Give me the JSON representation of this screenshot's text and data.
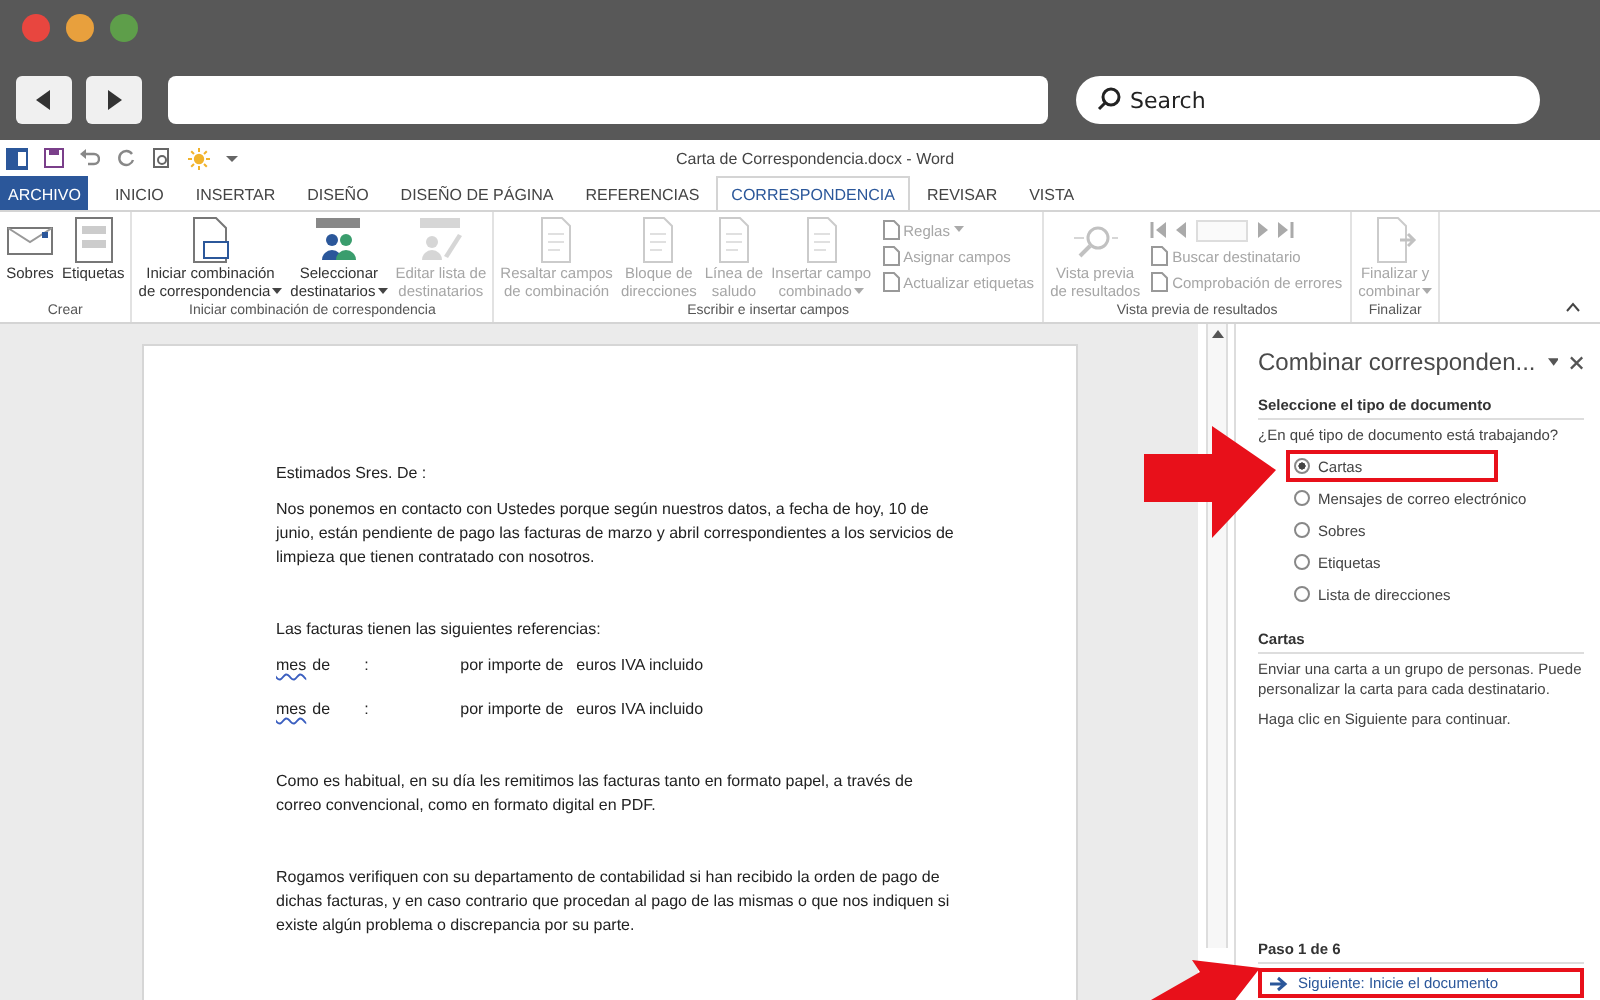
{
  "browser": {
    "search": {
      "placeholder": "Search"
    }
  },
  "word": {
    "title": "Carta de Correspondencia.docx - Word",
    "tabs": [
      {
        "label": "ARCHIVO",
        "kind": "file",
        "selected": false
      },
      {
        "label": "INICIO",
        "kind": "tab",
        "selected": false
      },
      {
        "label": "INSERTAR",
        "kind": "tab",
        "selected": false
      },
      {
        "label": "DISEÑO",
        "kind": "tab",
        "selected": false
      },
      {
        "label": "DISEÑO DE PÁGINA",
        "kind": "tab",
        "selected": false
      },
      {
        "label": "REFERENCIAS",
        "kind": "tab",
        "selected": false
      },
      {
        "label": "CORRESPONDENCIA",
        "kind": "tab",
        "selected": true
      },
      {
        "label": "REVISAR",
        "kind": "tab",
        "selected": false
      },
      {
        "label": "VISTA",
        "kind": "tab",
        "selected": false
      }
    ],
    "ribbon": [
      {
        "label": "Crear",
        "items": [
          {
            "kind": "large",
            "lines": [
              "Sobres"
            ],
            "dropdown": false,
            "disabled": false
          },
          {
            "kind": "large",
            "lines": [
              "Etiquetas"
            ],
            "dropdown": false,
            "disabled": false
          }
        ]
      },
      {
        "label": "Iniciar combinación de correspondencia",
        "items": [
          {
            "kind": "large",
            "lines": [
              "Iniciar combinación",
              "de correspondencia"
            ],
            "dropdown": true,
            "disabled": false
          },
          {
            "kind": "large",
            "lines": [
              "Seleccionar",
              "destinatarios"
            ],
            "dropdown": true,
            "disabled": false
          },
          {
            "kind": "large",
            "lines": [
              "Editar lista de",
              "destinatarios"
            ],
            "dropdown": false,
            "disabled": true
          }
        ]
      },
      {
        "label": "Escribir e insertar campos",
        "items": [
          {
            "kind": "large",
            "lines": [
              "Resaltar campos",
              "de combinación"
            ],
            "dropdown": false,
            "disabled": true
          },
          {
            "kind": "large",
            "lines": [
              "Bloque de",
              "direcciones"
            ],
            "dropdown": false,
            "disabled": true
          },
          {
            "kind": "large",
            "lines": [
              "Línea de",
              "saludo"
            ],
            "dropdown": false,
            "disabled": true
          },
          {
            "kind": "large",
            "lines": [
              "Insertar campo",
              "combinado"
            ],
            "dropdown": true,
            "disabled": true
          },
          {
            "kind": "stack",
            "items": [
              {
                "kind": "small",
                "label": "Reglas",
                "dropdown": true,
                "disabled": true
              },
              {
                "kind": "small",
                "label": "Asignar campos",
                "dropdown": false,
                "disabled": true
              },
              {
                "kind": "small",
                "label": "Actualizar etiquetas",
                "dropdown": false,
                "disabled": true
              }
            ]
          }
        ]
      },
      {
        "label": "Vista previa de resultados",
        "items": [
          {
            "kind": "large",
            "lines": [
              "Vista previa",
              "de resultados"
            ],
            "dropdown": false,
            "disabled": true
          },
          {
            "kind": "stack",
            "items": [
              {
                "kind": "nav",
                "disabled": true
              },
              {
                "kind": "small",
                "label": "Buscar destinatario",
                "dropdown": false,
                "disabled": true
              },
              {
                "kind": "small",
                "label": "Comprobación de errores",
                "dropdown": false,
                "disabled": true
              }
            ]
          }
        ]
      },
      {
        "label": "Finalizar",
        "items": [
          {
            "kind": "large",
            "lines": [
              "Finalizar y",
              "combinar"
            ],
            "dropdown": true,
            "disabled": true
          }
        ]
      }
    ],
    "document": [
      {
        "kind": "para",
        "text": "Estimados Sres. De   :"
      },
      {
        "kind": "para",
        "text": "Nos ponemos en contacto con Ustedes porque según nuestros datos, a fecha de hoy, 10 de junio, están pendiente de pago las facturas de marzo y abril correspondientes a los servicios de limpieza que tienen contratado con nosotros."
      },
      {
        "kind": "para_after_blank",
        "text": "Las facturas tienen las siguientes referencias:"
      },
      {
        "kind": "row",
        "cells": [
          {
            "text": "mes",
            "misspelled": true
          },
          {
            "text": "de",
            "misspelled": false
          },
          {
            "text": ":",
            "misspelled": false
          },
          {
            "text": "por importe de",
            "misspelled": false
          },
          {
            "text": "euros IVA incluido",
            "misspelled": false
          }
        ]
      },
      {
        "kind": "row",
        "cells": [
          {
            "text": "mes",
            "misspelled": true
          },
          {
            "text": "de",
            "misspelled": false
          },
          {
            "text": ":",
            "misspelled": false
          },
          {
            "text": "por importe de",
            "misspelled": false
          },
          {
            "text": "euros IVA incluido",
            "misspelled": false
          }
        ]
      },
      {
        "kind": "para_after_blank",
        "text": "Como es habitual, en su día les remitimos las facturas tanto en formato papel, a través de correo convencional, como en formato digital en PDF."
      },
      {
        "kind": "para_after_blank",
        "text": "Rogamos verifiquen con su departamento de contabilidad si han recibido la orden de pago de dichas facturas, y en caso contrario que procedan al pago de las mismas o que nos indiquen si existe algún problema o discrepancia por su parte."
      }
    ],
    "pane": {
      "title": "Combinar corresponden...",
      "section_1": "Seleccione el tipo de documento",
      "question": "¿En qué tipo de documento está trabajando?",
      "options": [
        {
          "label": "Cartas",
          "selected": true,
          "highlighted": true
        },
        {
          "label": "Mensajes de correo electrónico",
          "selected": false,
          "highlighted": false
        },
        {
          "label": "Sobres",
          "selected": false,
          "highlighted": false
        },
        {
          "label": "Etiquetas",
          "selected": false,
          "highlighted": false
        },
        {
          "label": "Lista de direcciones",
          "selected": false,
          "highlighted": false
        }
      ],
      "section_2": "Cartas",
      "paragraphs": [
        "Enviar una carta a un grupo de personas. Puede personalizar la carta para cada destinatario.",
        "Haga clic en Siguiente para continuar."
      ],
      "step": "Paso 1 de 6",
      "next_link": {
        "label": "Siguiente: Inicie el documento",
        "highlighted": true
      }
    }
  }
}
